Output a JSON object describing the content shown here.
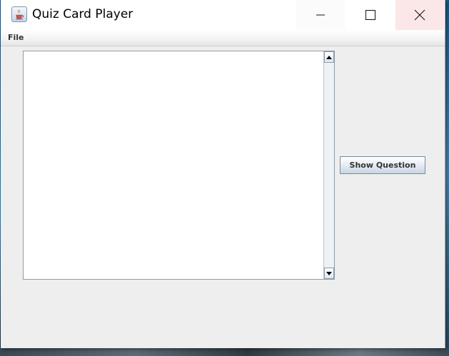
{
  "window": {
    "title": "Quiz Card Player"
  },
  "menubar": {
    "items": [
      {
        "label": "File"
      }
    ]
  },
  "question_area": {
    "value": ""
  },
  "actions": {
    "show_question_label": "Show Question"
  },
  "icons": {
    "app": "java-cup-icon",
    "minimize": "minimize-icon",
    "maximize": "maximize-icon",
    "close": "close-icon",
    "scroll_up": "arrow-up-icon",
    "scroll_down": "arrow-down-icon"
  },
  "colors": {
    "window_bg": "#eeeeee",
    "titlebar_bg": "#ffffff",
    "close_hover_bg": "#fbe7e7",
    "button_border": "#7a8a9c"
  }
}
